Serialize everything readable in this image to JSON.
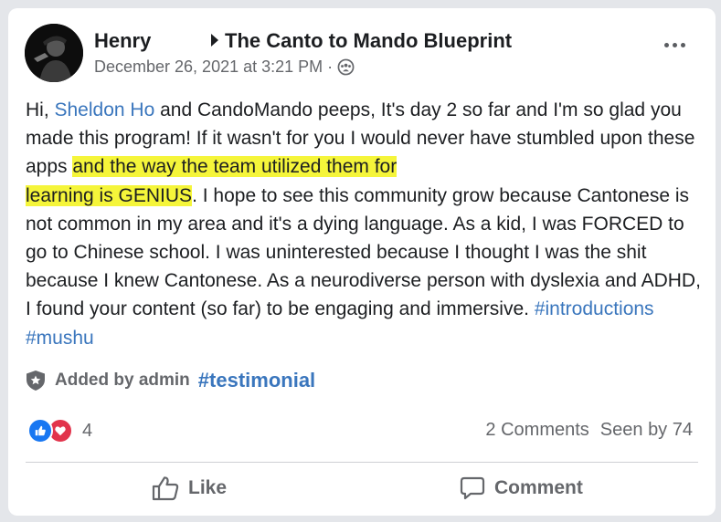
{
  "post": {
    "author": "Henry",
    "group": "The Canto to Mando Blueprint",
    "timestamp": "December 26, 2021 at 3:21 PM",
    "audience_separator": "·",
    "audience_icon": "group-audience-icon",
    "body": {
      "greeting": "Hi, ",
      "mention": "Sheldon Ho",
      "text_before_highlight": " and CandoMando peeps, It's day 2 so far and I'm so glad you made this program! If it wasn't for you I would never have stumbled upon these apps ",
      "highlight_line1": "and the way the team utilized them for",
      "highlight_line2": "learning is GENIUS",
      "text_after_highlight": ". I hope to see this community grow because Cantonese is not common in my area and it's a dying language. As a kid, I was FORCED to go to Chinese school. I was uninterested because I thought I was the shit because I knew Cantonese.  As a neurodiverse person with dyslexia and ADHD, I found your content (so far) to be engaging and immersive. ",
      "hashtag1": "#introductions",
      "hashtag2": "#mushu"
    },
    "added_by": "Added by admin",
    "topic": "#testimonial",
    "reaction_count": "4",
    "comments": "2 Comments",
    "seen_by": "Seen by 74",
    "actions": {
      "like": "Like",
      "comment": "Comment"
    },
    "colors": {
      "highlight": "#f5f53a",
      "link": "#3a76bd",
      "like_blue": "#1877f2",
      "love_red": "#e2344c"
    }
  }
}
